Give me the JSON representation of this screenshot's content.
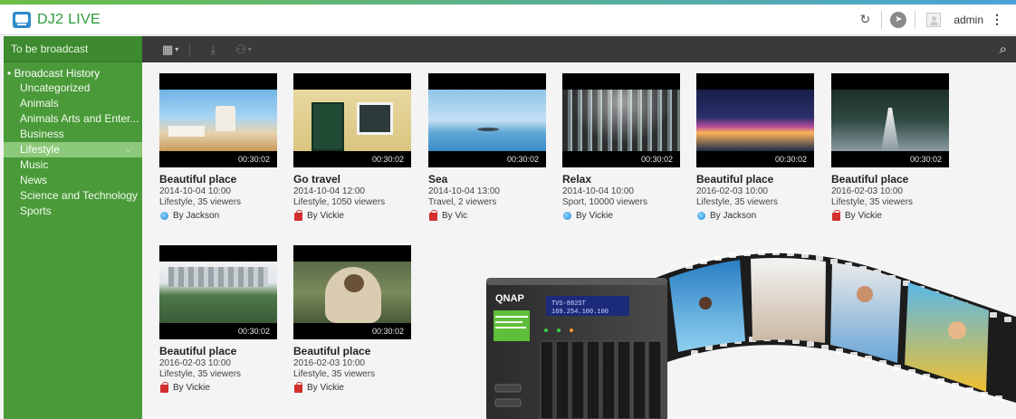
{
  "app": {
    "logo_text": "DJ2",
    "logo_sub": "LIVE"
  },
  "header": {
    "refresh_icon": "refresh-icon",
    "status_icon": "status-icon",
    "user_name": "admin",
    "more_icon": "kebab-icon"
  },
  "sidebar": {
    "top_label": "To be broadcast",
    "section_label": "• Broadcast History",
    "items": [
      {
        "label": "Uncategorized"
      },
      {
        "label": "Animals"
      },
      {
        "label": "Animals Arts and Enter..."
      },
      {
        "label": "Business"
      },
      {
        "label": "Lifestyle",
        "active": true
      },
      {
        "label": "Music"
      },
      {
        "label": "News"
      },
      {
        "label": "Science and Technology"
      },
      {
        "label": "Sports"
      }
    ]
  },
  "toolbar": {
    "view_icon": "grid-view-icon",
    "download_icon": "download-icon",
    "share_icon": "share-icon",
    "search_icon": "search-icon"
  },
  "videos": [
    {
      "title": "Beautiful place",
      "date": "2014-10-04  10:00",
      "meta": "Lifestyle, 35 viewers",
      "by": "By Jackson",
      "access": "public",
      "duration": "00:30:02"
    },
    {
      "title": "Go travel",
      "date": "2014-10-04  12:00",
      "meta": "Lifestyle, 1050 viewers",
      "by": "By Vickie",
      "access": "private",
      "duration": "00:30:02"
    },
    {
      "title": "Sea",
      "date": "2014-10-04  13:00",
      "meta": "Travel, 2 viewers",
      "by": "By Vic",
      "access": "private",
      "duration": "00:30:02"
    },
    {
      "title": "Relax",
      "date": "2014-10-04  10:00",
      "meta": "Sport, 10000 viewers",
      "by": "By Vickie",
      "access": "public",
      "duration": "00:30:02"
    },
    {
      "title": "Beautiful place",
      "date": "2016-02-03  10:00",
      "meta": "Lifestyle, 35 viewers",
      "by": "By Jackson",
      "access": "public",
      "duration": "00:30:02"
    },
    {
      "title": "Beautiful place",
      "date": "2016-02-03  10:00",
      "meta": "Lifestyle, 35 viewers",
      "by": "By Vickie",
      "access": "private",
      "duration": "00:30:02"
    },
    {
      "title": "Beautiful place",
      "date": "2016-02-03  10:00",
      "meta": "Lifestyle, 35 viewers",
      "by": "By Vickie",
      "access": "private",
      "duration": "00:30:02"
    },
    {
      "title": "Beautiful place",
      "date": "2016-02-03  10:00",
      "meta": "Lifestyle, 35 viewers",
      "by": "By Vickie",
      "access": "private",
      "duration": "00:30:02"
    }
  ],
  "banner": {
    "nas_brand": "QNAP",
    "nas_model": "TVS-882ST",
    "nas_ip": "169.254.100.100"
  }
}
